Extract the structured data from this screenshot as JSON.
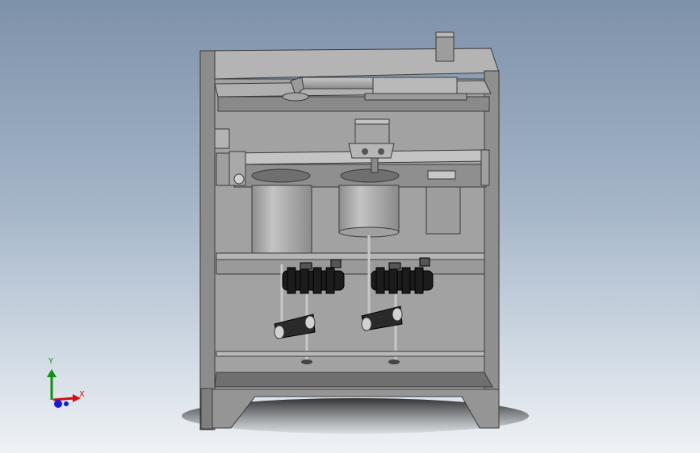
{
  "viewport": {
    "background_top": "#7d91a9",
    "background_bottom": "#eef2f5"
  },
  "model": {
    "body_color": "#9a9a9a",
    "frame_color": "#8b8b8b",
    "shadow_color": "#2f2f2f",
    "tank_color": "#a9a9a9",
    "gear_color": "#1c1c1c"
  },
  "triad": {
    "x_label": "X",
    "y_label": "Y",
    "x_color": "#d01010",
    "y_color": "#109010",
    "z_color": "#1a1ad0"
  }
}
